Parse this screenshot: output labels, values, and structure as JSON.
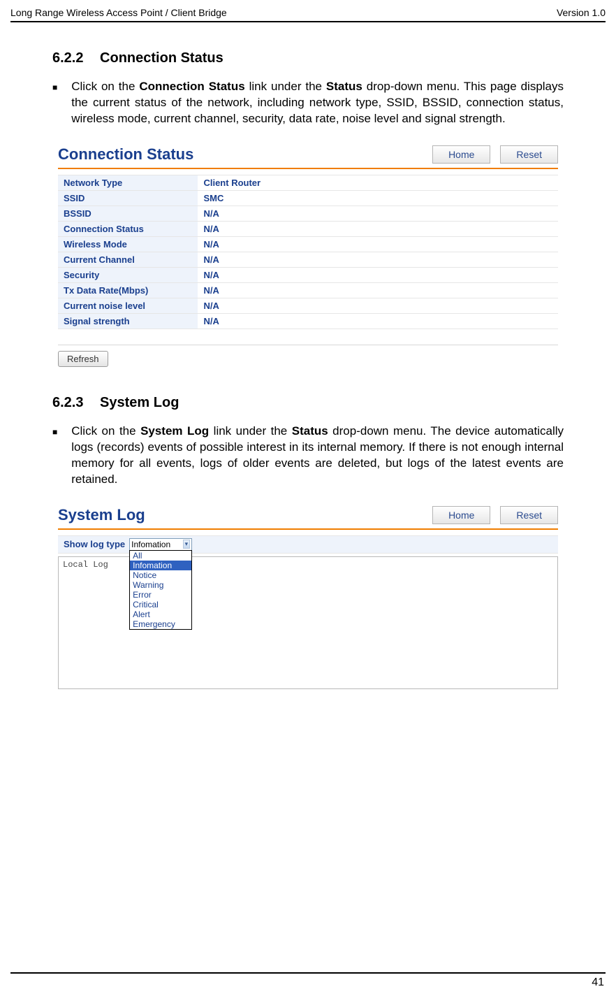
{
  "runner": {
    "left": "Long Range Wireless Access Point / Client Bridge",
    "right": "Version 1.0"
  },
  "page_number": "41",
  "sections": {
    "s1": {
      "num": "6.2.2",
      "title": "Connection Status",
      "para_prefix": "Click on the ",
      "bold1": "Connection Status",
      "mid1": " link under the ",
      "bold2": "Status",
      "rest": " drop-down menu. This page displays the current status of the network, including network type, SSID,  BSSID, connection status, wireless mode, current channel, security, data rate, noise level and signal strength."
    },
    "s2": {
      "num": "6.2.3",
      "title": "System Log",
      "para_prefix": "Click on the ",
      "bold1": "System Log",
      "mid1": " link under the ",
      "bold2": "Status",
      "rest": " drop-down menu. The device automatically logs (records) events of possible interest in its internal memory. If there is not enough internal memory for all events, logs of older events are deleted, but logs of the latest events are retained."
    }
  },
  "panel1": {
    "title": "Connection Status",
    "home": "Home",
    "reset": "Reset",
    "refresh": "Refresh",
    "rows": {
      "r0l": "Network Type",
      "r0v": "Client Router",
      "r1l": "SSID",
      "r1v": "SMC",
      "r2l": "BSSID",
      "r2v": "N/A",
      "r3l": "Connection Status",
      "r3v": "N/A",
      "r4l": "Wireless Mode",
      "r4v": "N/A",
      "r5l": "Current Channel",
      "r5v": "N/A",
      "r6l": "Security",
      "r6v": "N/A",
      "r7l": "Tx Data Rate(Mbps)",
      "r7v": "N/A",
      "r8l": "Current noise level",
      "r8v": "N/A",
      "r9l": "Signal strength",
      "r9v": "N/A"
    }
  },
  "panel2": {
    "title": "System Log",
    "home": "Home",
    "reset": "Reset",
    "logtypelabel": "Show log type",
    "selected": "Infomation",
    "options": {
      "o0": "All",
      "o1": "Infomation",
      "o2": "Notice",
      "o3": "Warning",
      "o4": "Error",
      "o5": "Critical",
      "o6": "Alert",
      "o7": "Emergency"
    },
    "logtext": "Local Log"
  }
}
